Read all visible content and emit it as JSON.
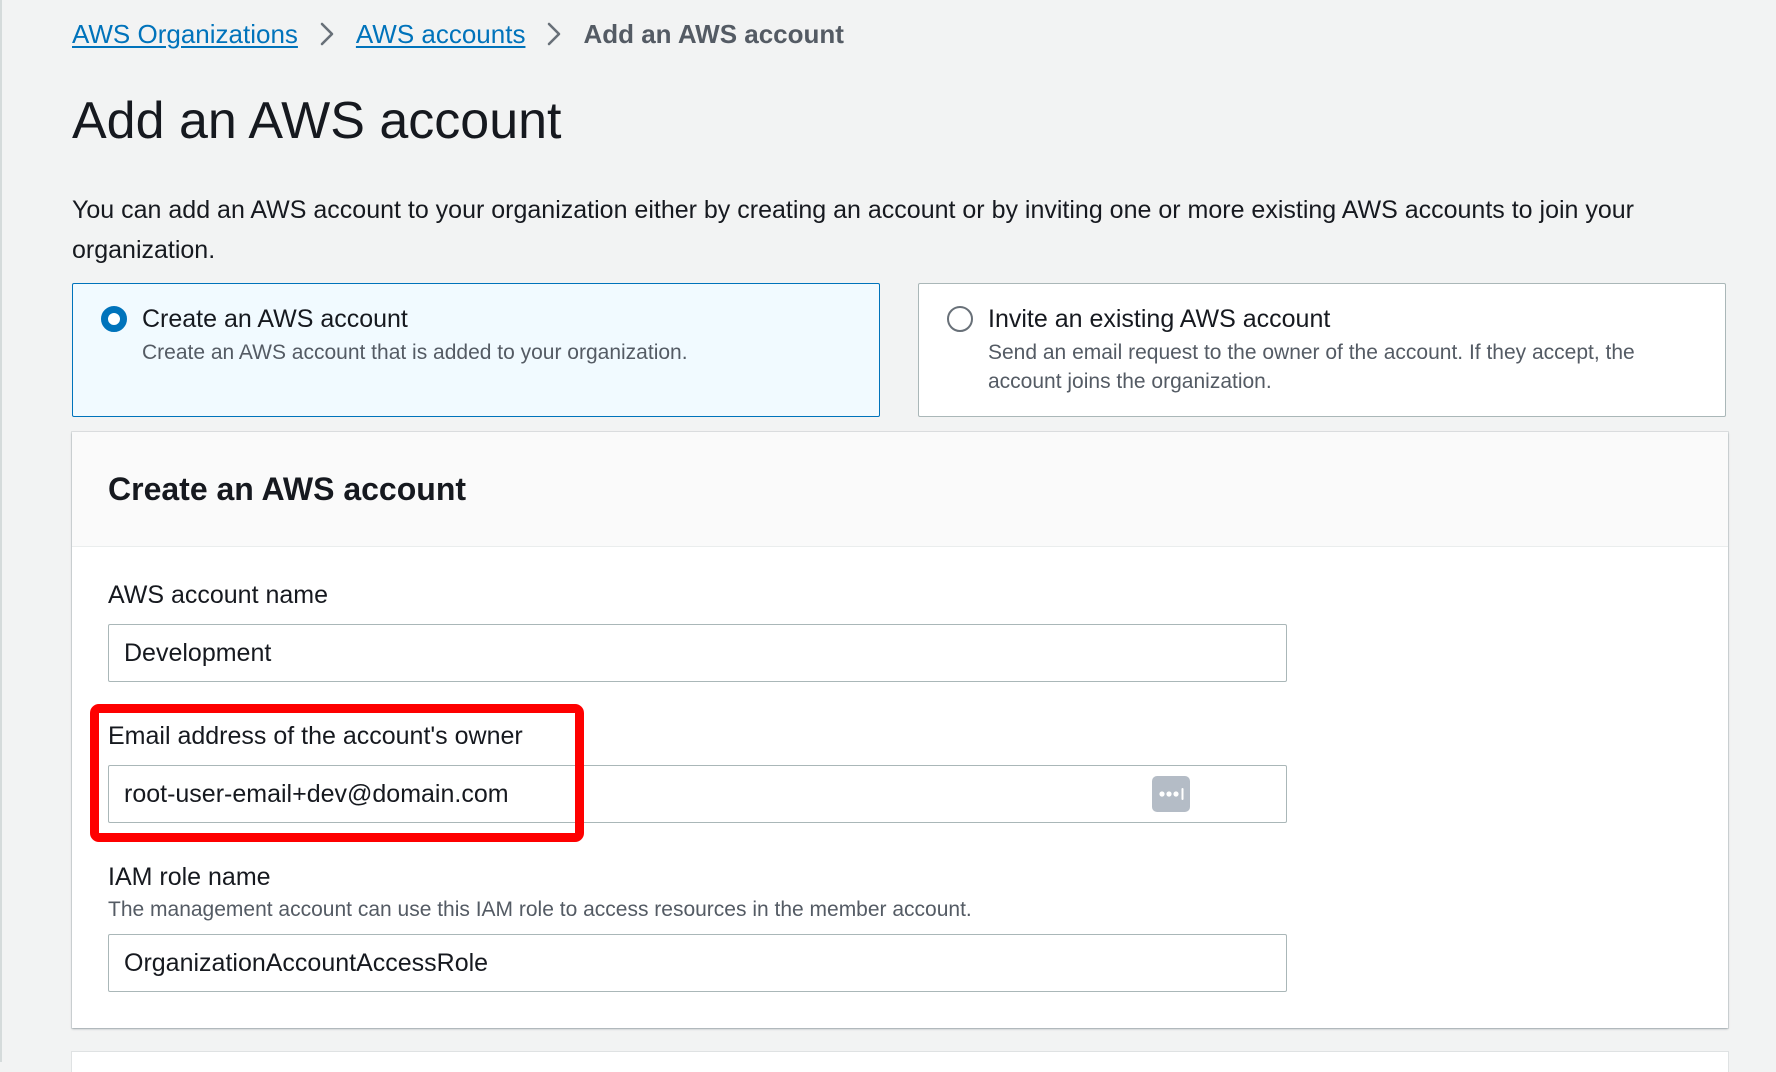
{
  "breadcrumb": {
    "items": [
      {
        "label": "AWS Organizations"
      },
      {
        "label": "AWS accounts"
      }
    ],
    "current": "Add an AWS account"
  },
  "page": {
    "title": "Add an AWS account",
    "description": "You can add an AWS account to your organization either by creating an account or by inviting one or more existing AWS accounts to join your organization."
  },
  "options": {
    "create": {
      "title": "Create an AWS account",
      "description": "Create an AWS account that is added to your organization.",
      "selected": true
    },
    "invite": {
      "title": "Invite an existing AWS account",
      "description": "Send an email request to the owner of the account. If they accept, the account joins the organization.",
      "selected": false
    }
  },
  "form": {
    "title": "Create an AWS account",
    "account_name": {
      "label": "AWS account name",
      "value": "Development"
    },
    "email": {
      "label": "Email address of the account's owner",
      "value": "root-user-email+dev@domain.com",
      "icon": "password-manager-icon"
    },
    "iam_role": {
      "label": "IAM role name",
      "description": "The management account can use this IAM role to access resources in the member account.",
      "value": "OrganizationAccountAccessRole"
    }
  },
  "colors": {
    "link": "#0073bb",
    "selected_tile_bg": "#f1faff",
    "highlight": "#fe0000",
    "page_bg": "#f2f3f3"
  }
}
